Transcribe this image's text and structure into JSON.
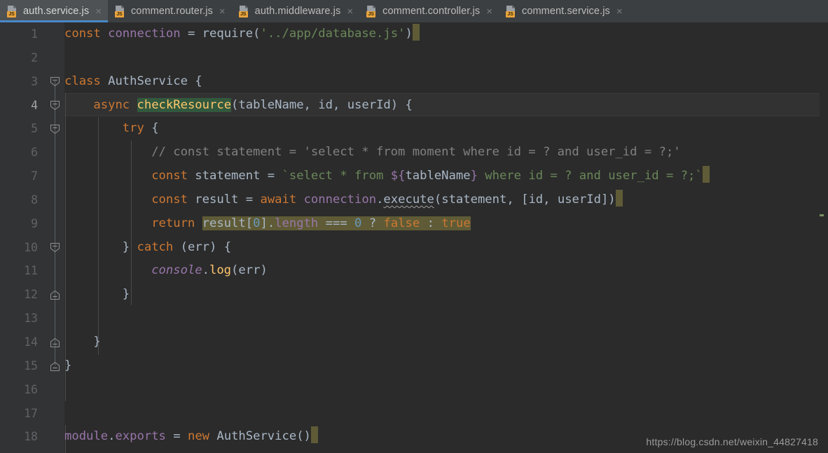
{
  "window": {
    "app": "code-editor",
    "theme_colors": {
      "editor_bg": "#2b2b2b",
      "gutter_bg": "#313335",
      "tabbar_bg": "#3c3f41",
      "active_tab_bg": "#4e5254",
      "active_tab_underline": "#4a88c7",
      "keyword": "#cc7832",
      "string": "#6a8759",
      "comment": "#808080",
      "number": "#6897bb",
      "function": "#ffc66d",
      "field": "#9876aa",
      "default_text": "#a9b7c6",
      "selection": "#5f5b36",
      "identifier_highlight": "#32593d",
      "current_line": "#323232"
    }
  },
  "tabs": [
    {
      "label": "auth.service.js",
      "icon": "js-file-icon",
      "badge": "JS",
      "close": "×",
      "active": true
    },
    {
      "label": "comment.router.js",
      "icon": "js-file-icon",
      "badge": "JS",
      "close": "×",
      "active": false
    },
    {
      "label": "auth.middleware.js",
      "icon": "js-file-icon",
      "badge": "JS",
      "close": "×",
      "active": false
    },
    {
      "label": "comment.controller.js",
      "icon": "js-file-icon",
      "badge": "JS",
      "close": "×",
      "active": false
    },
    {
      "label": "comment.service.js",
      "icon": "js-file-icon",
      "badge": "JS",
      "close": "×",
      "active": false
    }
  ],
  "editor": {
    "current_line": 4,
    "line_numbers": [
      "1",
      "2",
      "3",
      "4",
      "5",
      "6",
      "7",
      "8",
      "9",
      "10",
      "11",
      "12",
      "13",
      "14",
      "15",
      "16",
      "17",
      "18"
    ],
    "lines": [
      {
        "n": "1",
        "text": "const connection = require('../app/database.js')"
      },
      {
        "n": "2",
        "text": ""
      },
      {
        "n": "3",
        "text": "class AuthService {"
      },
      {
        "n": "4",
        "text": "    async checkResource(tableName, id, userId) {"
      },
      {
        "n": "5",
        "text": "        try {"
      },
      {
        "n": "6",
        "text": "            // const statement = 'select * from moment where id = ? and user_id = ?;'"
      },
      {
        "n": "7",
        "text": "            const statement = `select * from ${tableName} where id = ? and user_id = ?;`"
      },
      {
        "n": "8",
        "text": "            const result = await connection.execute(statement, [id, userId])"
      },
      {
        "n": "9",
        "text": "            return result[0].length === 0 ? false : true"
      },
      {
        "n": "10",
        "text": "        } catch (err) {"
      },
      {
        "n": "11",
        "text": "            console.log(err)"
      },
      {
        "n": "12",
        "text": "        }"
      },
      {
        "n": "13",
        "text": ""
      },
      {
        "n": "14",
        "text": "    }"
      },
      {
        "n": "15",
        "text": "}"
      },
      {
        "n": "16",
        "text": ""
      },
      {
        "n": "17",
        "text": ""
      },
      {
        "n": "18",
        "text": "module.exports = new AuthService()"
      }
    ],
    "selection_text": "result[0].length === 0 ? false : true",
    "highlighted_identifier": "checkResource",
    "warning_token": "execute",
    "fold_markers": [
      {
        "line": "3",
        "state": "expanded"
      },
      {
        "line": "4",
        "state": "expanded"
      },
      {
        "line": "5",
        "state": "expanded"
      },
      {
        "line": "10",
        "state": "expanded"
      },
      {
        "line": "12",
        "state": "collapse-end"
      },
      {
        "line": "14",
        "state": "collapse-end"
      },
      {
        "line": "15",
        "state": "collapse-end"
      }
    ]
  },
  "watermark": {
    "text": "https://blog.csdn.net/weixin_44827418"
  }
}
